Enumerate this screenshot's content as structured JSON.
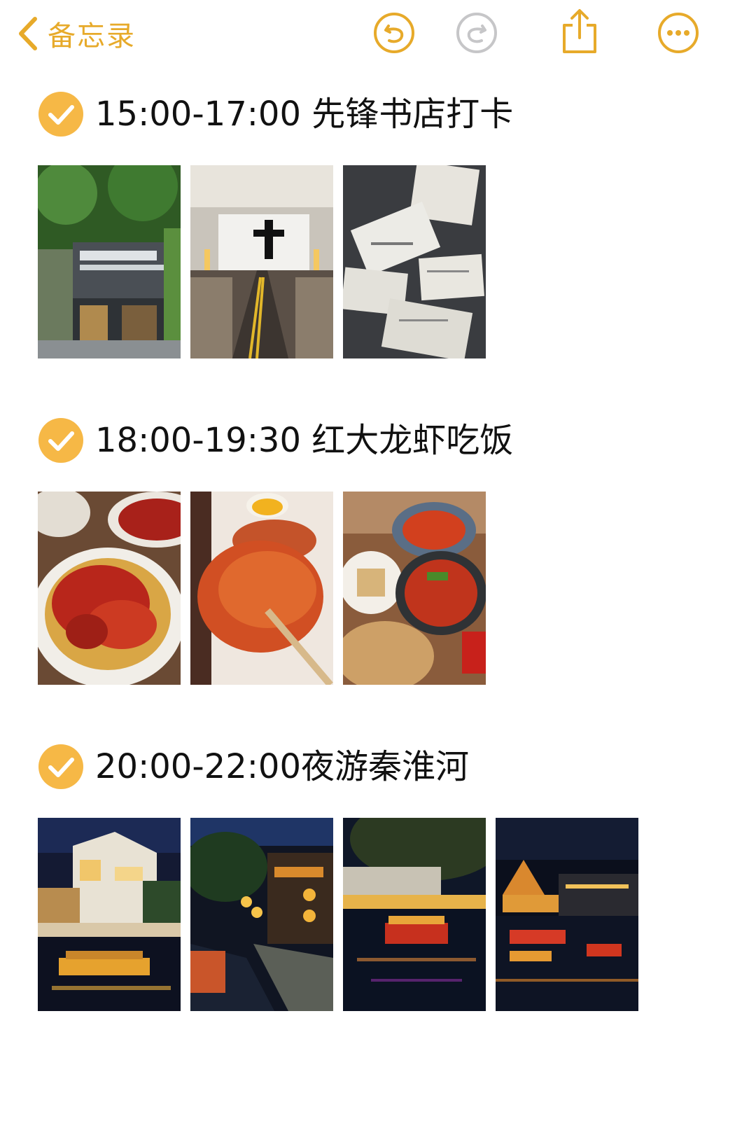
{
  "toolbar": {
    "back_label": "备忘录",
    "back_icon": "chevron-left-icon",
    "undo_icon": "undo-icon",
    "redo_icon": "redo-icon",
    "share_icon": "share-icon",
    "more_icon": "ellipsis-icon"
  },
  "colors": {
    "accent": "#e7aa2a",
    "check_fill": "#f6b846",
    "disabled": "#c6c6c8",
    "text": "#111111"
  },
  "items": [
    {
      "checked": true,
      "time_text": "15:00-17:00  先锋书店打卡",
      "photos": [
        "bookstore entrance sign",
        "bookstore hall with cross",
        "handwritten postcards"
      ]
    },
    {
      "checked": true,
      "time_text": "18:00-19:30 红大龙虾吃饭",
      "photos": [
        "crawfish plate",
        "fried chicken cutlet",
        "crawfish table spread"
      ]
    },
    {
      "checked": true,
      "time_text": "20:00-22:00夜游秦淮河",
      "photos": [
        "night riverside building",
        "lantern street at night",
        "boat on river at night",
        "illuminated river panorama"
      ]
    }
  ]
}
